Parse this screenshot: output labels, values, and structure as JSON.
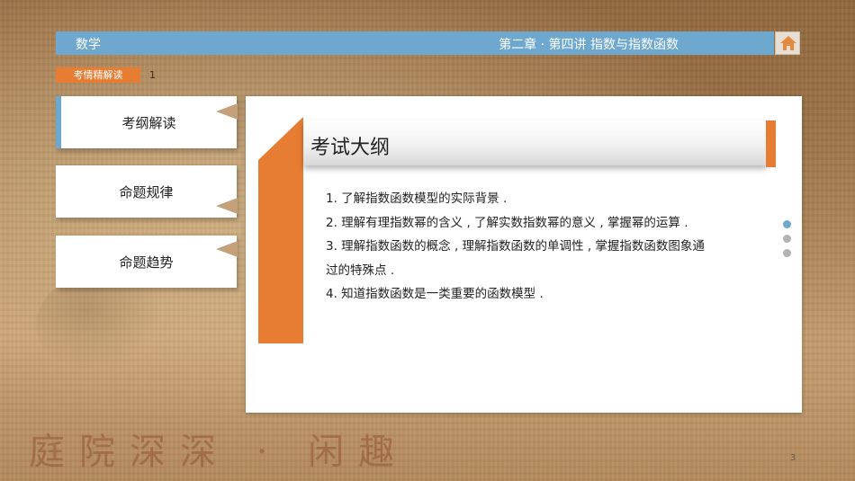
{
  "header": {
    "subject": "数学",
    "chapter": "第二章 · 第四讲 指数与指数函数"
  },
  "icons": {
    "home": "home-icon"
  },
  "tag": {
    "label": "考情精解读",
    "number": "1"
  },
  "nav": {
    "items": [
      {
        "label": "考纲解读"
      },
      {
        "label": "命题规律"
      },
      {
        "label": "命题趋势"
      }
    ]
  },
  "panel": {
    "title": "考试大纲",
    "lines": [
      "1. 了解指数函数模型的实际背景 .",
      "2. 理解有理指数幂的含义 , 了解实数指数幂的意义 , 掌握幂的运算 .",
      "3. 理解指数函数的概念 , 理解指数函数的单调性 , 掌握指数函数图象通",
      "过的特殊点 .",
      "4. 知道指数函数是一类重要的函数模型 ."
    ]
  },
  "pagination": {
    "count": 3,
    "active_index": 0,
    "active_color": "#6ea8cf",
    "inactive_color": "#b3b3b3"
  },
  "colors": {
    "accent_blue": "#6ea8cf",
    "accent_orange": "#e67d33"
  },
  "watermark": "庭院深深 · 闲趣",
  "page_number": "3"
}
